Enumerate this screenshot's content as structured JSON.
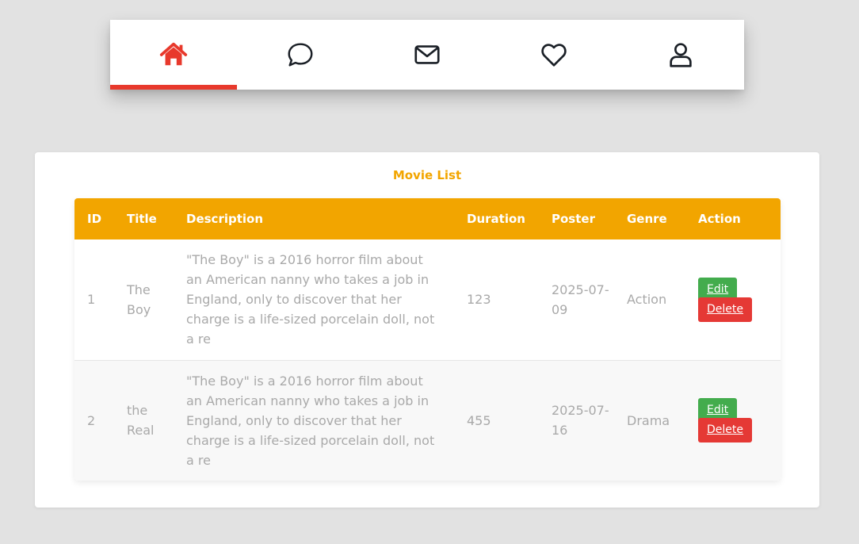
{
  "colors": {
    "accent": "#f2a500",
    "active": "#e8392c",
    "icon": "#1a1f26",
    "edit": "#43ac4d",
    "delete": "#e53935"
  },
  "nav": {
    "items": [
      {
        "icon": "home-icon",
        "active": true
      },
      {
        "icon": "chat-icon",
        "active": false
      },
      {
        "icon": "mail-icon",
        "active": false
      },
      {
        "icon": "heart-icon",
        "active": false
      },
      {
        "icon": "user-icon",
        "active": false
      }
    ]
  },
  "card": {
    "title": "Movie List"
  },
  "table": {
    "headers": [
      "ID",
      "Title",
      "Description",
      "Duration",
      "Poster",
      "Genre",
      "Action"
    ],
    "rows": [
      {
        "id": "1",
        "title": "The Boy",
        "description": "\"The Boy\" is a 2016 horror film about an American nanny who takes a job in England, only to discover that her charge is a life-sized porcelain doll, not a re",
        "duration": "123",
        "poster": "2025-07-09",
        "genre": "Action",
        "edit_label": "Edit",
        "delete_label": "Delete"
      },
      {
        "id": "2",
        "title": "the Real",
        "description": "\"The Boy\" is a 2016 horror film about an American nanny who takes a job in England, only to discover that her charge is a life-sized porcelain doll, not a re",
        "duration": "455",
        "poster": "2025-07-16",
        "genre": "Drama",
        "edit_label": "Edit",
        "delete_label": "Delete"
      }
    ]
  }
}
